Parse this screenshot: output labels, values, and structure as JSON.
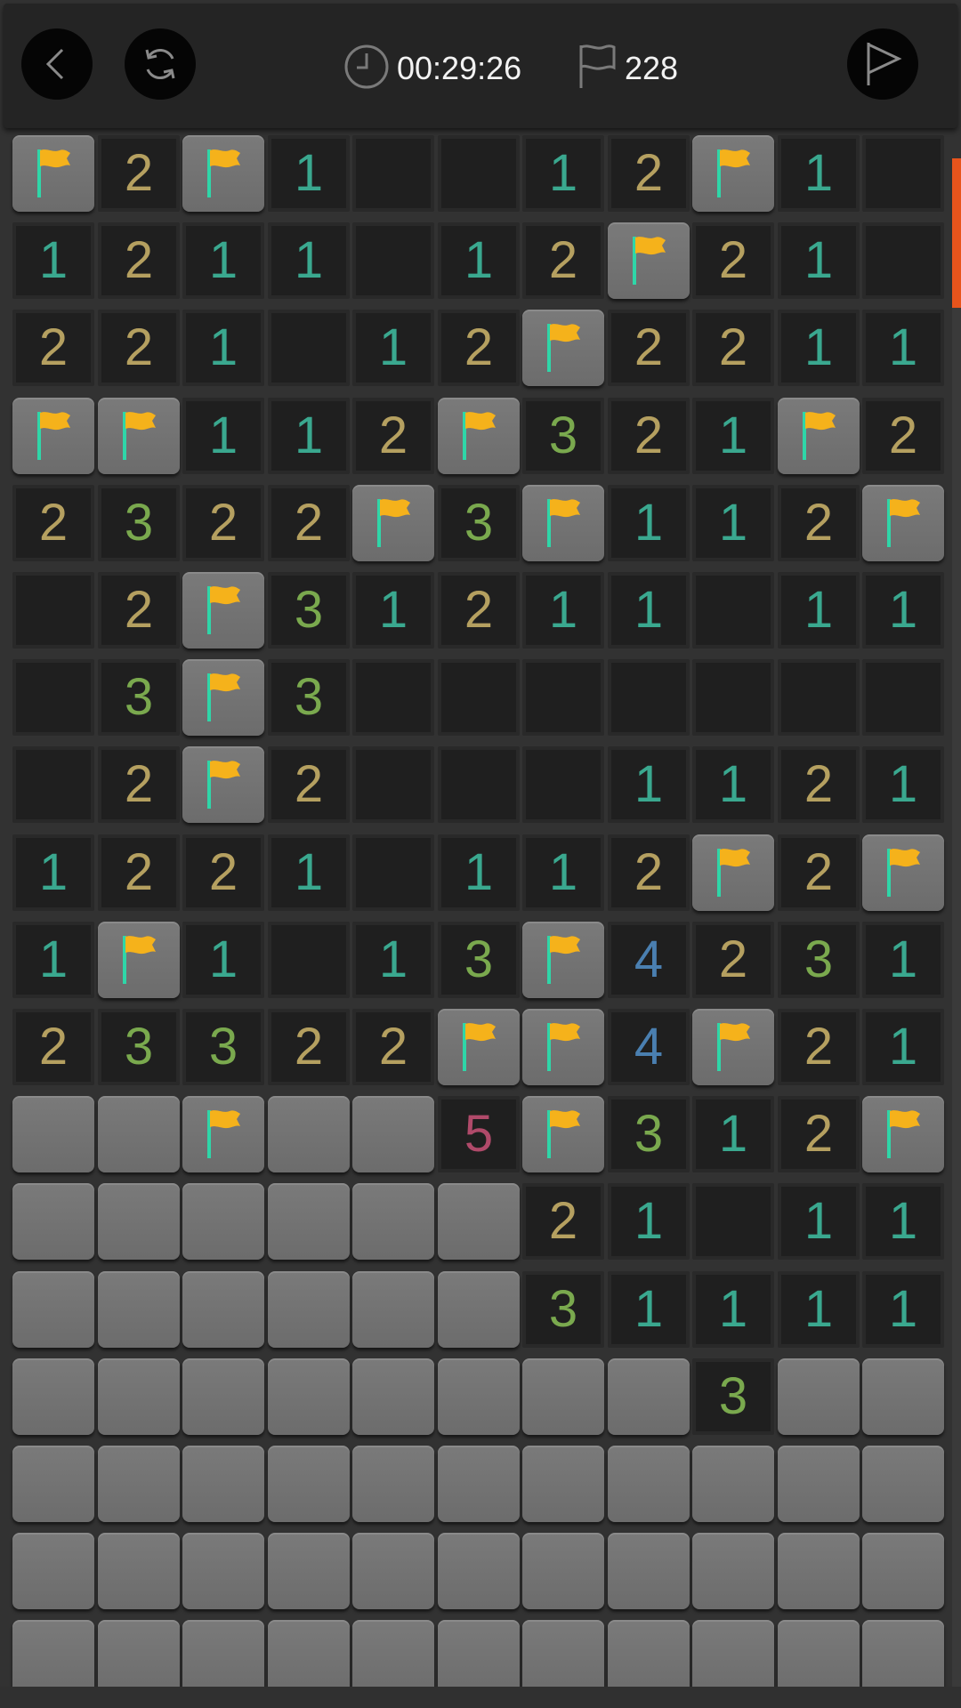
{
  "header": {
    "back_icon": "chevron-left-icon",
    "restart_icon": "refresh-icon",
    "timer_icon": "clock-icon",
    "timer": "00:29:26",
    "flag_icon": "flag-outline-icon",
    "flag_count": "228",
    "play_icon": "play-icon"
  },
  "colors": {
    "1": "#3aa88f",
    "2": "#b5a060",
    "3": "#7aa94e",
    "4": "#4a7fb0",
    "5": "#b04a6a",
    "flag": "#f5b21b",
    "flag_pole": "#2fd6a8",
    "accent": "#e8541c"
  },
  "board": {
    "columns": 11,
    "visible_rows": 18,
    "legend": "F = flag, H = hidden, 0 = open empty, digit = count",
    "rows": [
      [
        "F",
        "2",
        "F",
        "1",
        "0",
        "0",
        "1",
        "2",
        "F",
        "1",
        "0"
      ],
      [
        "1",
        "2",
        "1",
        "1",
        "0",
        "1",
        "2",
        "F",
        "2",
        "1",
        "0"
      ],
      [
        "2",
        "2",
        "1",
        "0",
        "1",
        "2",
        "F",
        "2",
        "2",
        "1",
        "1"
      ],
      [
        "F",
        "F",
        "1",
        "1",
        "2",
        "F",
        "3",
        "2",
        "1",
        "F",
        "2"
      ],
      [
        "2",
        "3",
        "2",
        "2",
        "F",
        "3",
        "F",
        "1",
        "1",
        "2",
        "F"
      ],
      [
        "0",
        "2",
        "F",
        "3",
        "1",
        "2",
        "1",
        "1",
        "0",
        "1",
        "1"
      ],
      [
        "0",
        "3",
        "F",
        "3",
        "0",
        "0",
        "0",
        "0",
        "0",
        "0",
        "0"
      ],
      [
        "0",
        "2",
        "F",
        "2",
        "0",
        "0",
        "0",
        "1",
        "1",
        "2",
        "1"
      ],
      [
        "1",
        "2",
        "2",
        "1",
        "0",
        "1",
        "1",
        "2",
        "F",
        "2",
        "F"
      ],
      [
        "1",
        "F",
        "1",
        "0",
        "1",
        "3",
        "F",
        "4",
        "2",
        "3",
        "1"
      ],
      [
        "2",
        "3",
        "3",
        "2",
        "2",
        "F",
        "F",
        "4",
        "F",
        "2",
        "1"
      ],
      [
        "H",
        "H",
        "F",
        "H",
        "H",
        "5",
        "F",
        "3",
        "1",
        "2",
        "F"
      ],
      [
        "H",
        "H",
        "H",
        "H",
        "H",
        "H",
        "2",
        "1",
        "0",
        "1",
        "1"
      ],
      [
        "H",
        "H",
        "H",
        "H",
        "H",
        "H",
        "3",
        "1",
        "1",
        "1",
        "1"
      ],
      [
        "H",
        "H",
        "H",
        "H",
        "H",
        "H",
        "H",
        "H",
        "3",
        "H",
        "H"
      ],
      [
        "H",
        "H",
        "H",
        "H",
        "H",
        "H",
        "H",
        "H",
        "H",
        "H",
        "H"
      ],
      [
        "H",
        "H",
        "H",
        "H",
        "H",
        "H",
        "H",
        "H",
        "H",
        "H",
        "H"
      ],
      [
        "H",
        "H",
        "H",
        "H",
        "H",
        "H",
        "H",
        "H",
        "H",
        "H",
        "H"
      ]
    ]
  }
}
